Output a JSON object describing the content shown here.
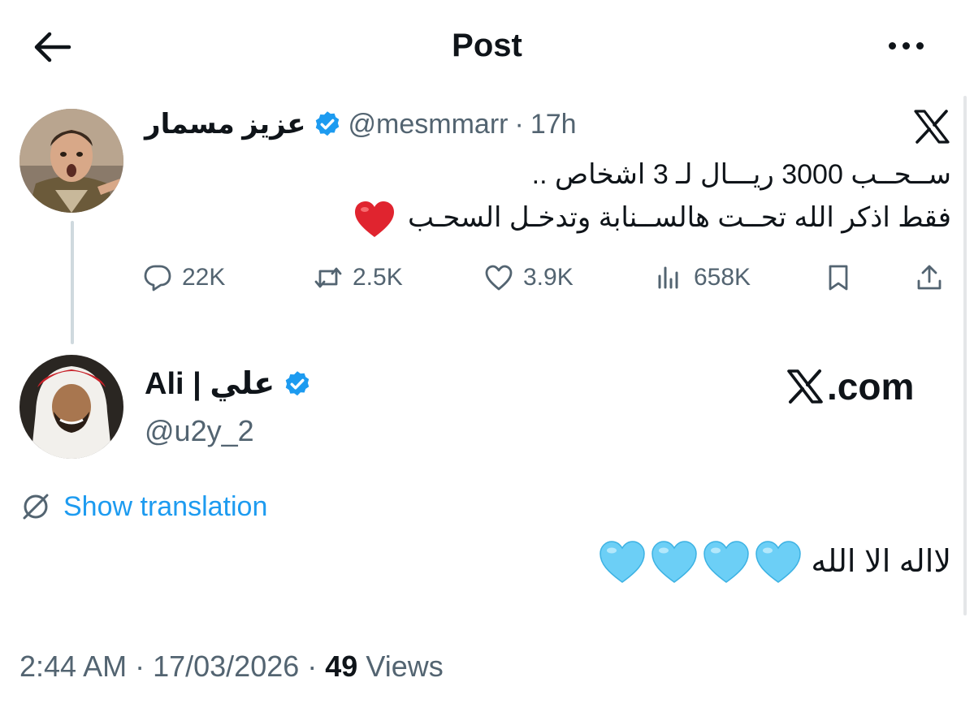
{
  "header": {
    "title": "Post",
    "back_icon": "arrow-left-icon",
    "more_icon": "more-horizontal-icon"
  },
  "parent_tweet": {
    "author_name": "عزيز مسمار",
    "handle": "@mesmmarr",
    "separator": "·",
    "time": "17h",
    "text_line1": "ســحــب 3000 ريـــال لـ 3 اشخاص ..",
    "text_line2": "فقط اذكر الله تحــت هالســنابة وتدخـل السحـب",
    "text_emoji": "red-heart",
    "actions": {
      "replies": "22K",
      "reposts": "2.5K",
      "likes": "3.9K",
      "views": "658K"
    }
  },
  "reply": {
    "author_name": "Ali | علي",
    "handle": "@u2y_2",
    "x_com": ".com",
    "show_translation": "Show translation",
    "text": "لااله الا الله",
    "emoji_count": 4,
    "emoji": "light-blue-heart"
  },
  "meta": {
    "time": "2:44 AM",
    "sep1": "·",
    "date": "17/03/2026",
    "sep2": "·",
    "views_count": "49",
    "views_label": "Views"
  },
  "colors": {
    "accent": "#1d9bf0",
    "text": "#0f1419",
    "muted": "#536471",
    "verified": "#1d9bf0",
    "heart_red": "#e0242f",
    "heart_blue": "#6ccff6"
  }
}
